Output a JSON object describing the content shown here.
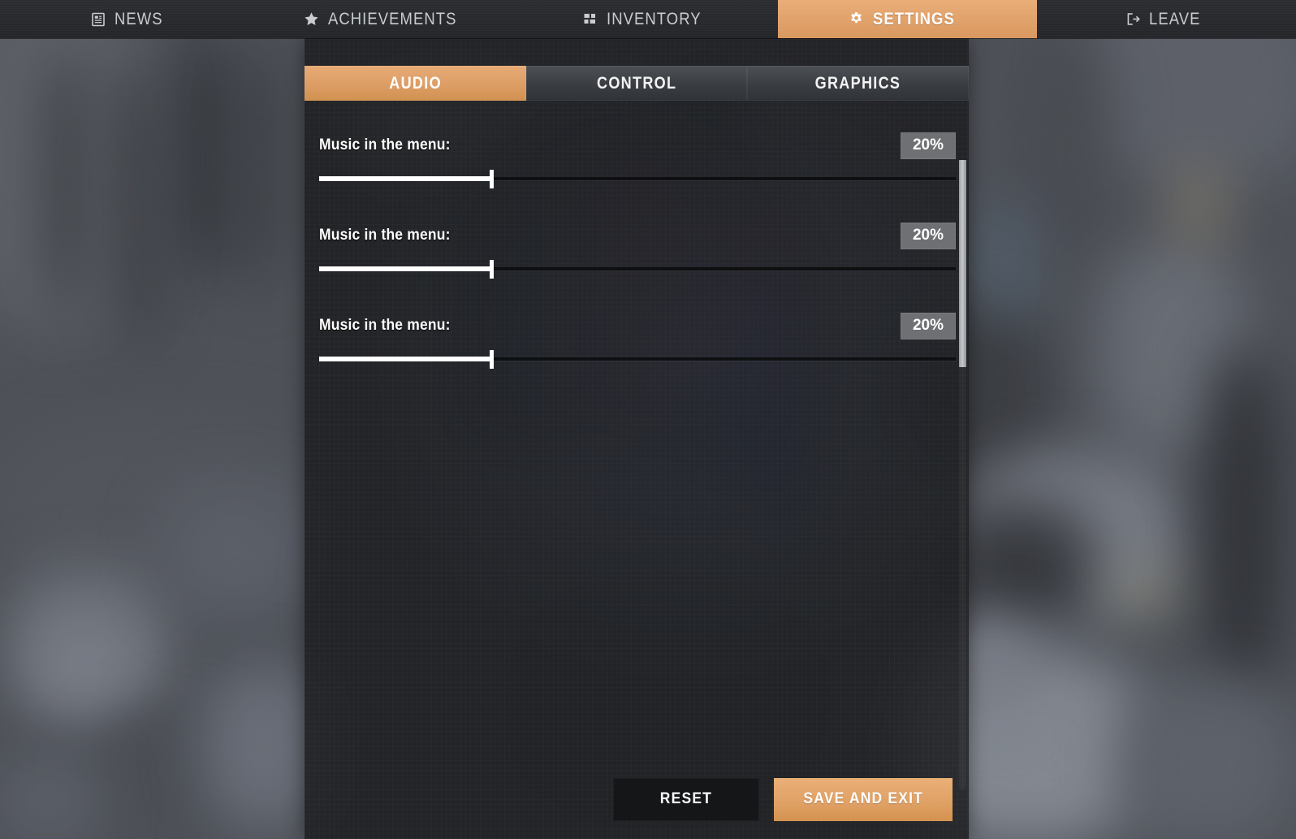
{
  "topnav": {
    "items": [
      {
        "label": "NEWS",
        "icon": "news-icon",
        "active": false
      },
      {
        "label": "ACHIEVEMENTS",
        "icon": "star-icon",
        "active": false
      },
      {
        "label": "INVENTORY",
        "icon": "grid-icon",
        "active": false
      },
      {
        "label": "SETTINGS",
        "icon": "gear-icon",
        "active": true
      },
      {
        "label": "LEAVE",
        "icon": "exit-icon",
        "active": false
      }
    ]
  },
  "settings": {
    "subtabs": [
      {
        "label": "AUDIO",
        "active": true
      },
      {
        "label": "CONTROL",
        "active": false
      },
      {
        "label": "GRAPHICS",
        "active": false
      }
    ],
    "rows": [
      {
        "label": "Music in the menu:",
        "value": "20%",
        "percent": 27
      },
      {
        "label": "Music in the menu:",
        "value": "20%",
        "percent": 27
      },
      {
        "label": "Music in the menu:",
        "value": "20%",
        "percent": 27
      }
    ],
    "footer": {
      "reset_label": "RESET",
      "save_label": "SAVE AND EXIT"
    }
  },
  "colors": {
    "accent": "#dfa064",
    "panel_bg": "#1c1d20",
    "badge_bg": "#6e7073",
    "text": "#ffffff"
  }
}
